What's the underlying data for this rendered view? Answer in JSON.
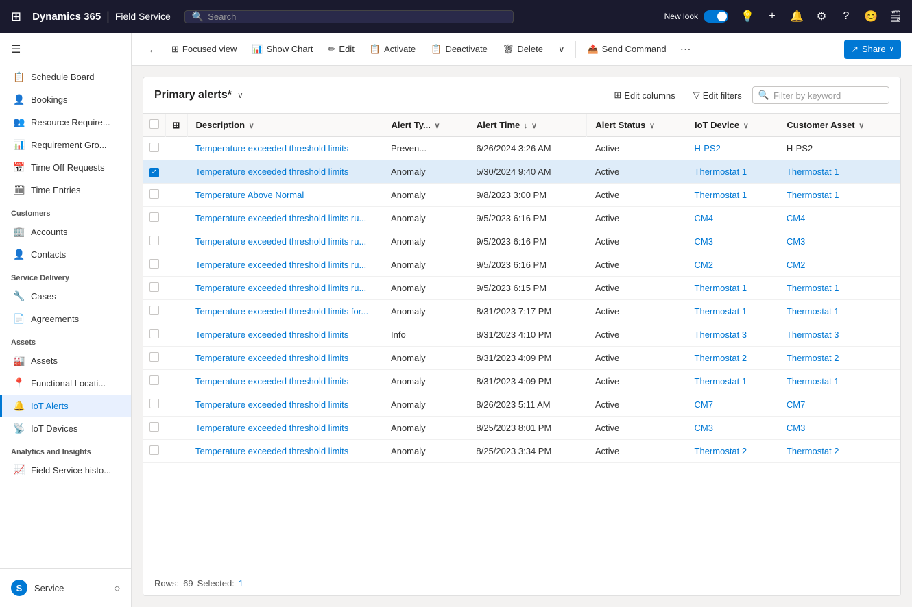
{
  "app": {
    "title": "Dynamics 365",
    "module": "Field Service",
    "search_placeholder": "Search"
  },
  "topnav": {
    "new_look_label": "New look",
    "icons": [
      "💡",
      "+",
      "🔔",
      "⚙",
      "?",
      "😊",
      "🗒"
    ]
  },
  "sidebar": {
    "sections": [
      {
        "items": [
          {
            "id": "schedule-board",
            "label": "Schedule Board",
            "icon": "📋"
          },
          {
            "id": "bookings",
            "label": "Bookings",
            "icon": "👤"
          }
        ]
      },
      {
        "items": [
          {
            "id": "resource-require",
            "label": "Resource Require...",
            "icon": "👥"
          },
          {
            "id": "requirement-gro",
            "label": "Requirement Gro...",
            "icon": "📊"
          },
          {
            "id": "time-off-requests",
            "label": "Time Off Requests",
            "icon": "📅"
          },
          {
            "id": "time-entries",
            "label": "Time Entries",
            "icon": "🗓"
          }
        ]
      },
      {
        "label": "Customers",
        "items": [
          {
            "id": "accounts",
            "label": "Accounts",
            "icon": "🏢"
          },
          {
            "id": "contacts",
            "label": "Contacts",
            "icon": "👤"
          }
        ]
      },
      {
        "label": "Service Delivery",
        "items": [
          {
            "id": "cases",
            "label": "Cases",
            "icon": "🔧"
          },
          {
            "id": "agreements",
            "label": "Agreements",
            "icon": "📄"
          }
        ]
      },
      {
        "label": "Assets",
        "items": [
          {
            "id": "assets",
            "label": "Assets",
            "icon": "🏭"
          },
          {
            "id": "functional-locati",
            "label": "Functional Locati...",
            "icon": "📍"
          },
          {
            "id": "iot-alerts",
            "label": "IoT Alerts",
            "icon": "🔔"
          },
          {
            "id": "iot-devices",
            "label": "IoT Devices",
            "icon": "📡"
          }
        ]
      },
      {
        "label": "Analytics and Insights",
        "items": [
          {
            "id": "field-service-histo",
            "label": "Field Service histo...",
            "icon": "📈"
          }
        ]
      }
    ],
    "bottom": {
      "label": "Service",
      "badge": "S",
      "chevron": "◇"
    }
  },
  "toolbar": {
    "back_label": "←",
    "focused_view_label": "Focused view",
    "show_chart_label": "Show Chart",
    "edit_label": "Edit",
    "activate_label": "Activate",
    "deactivate_label": "Deactivate",
    "delete_label": "Delete",
    "send_command_label": "Send Command",
    "more_label": "⋯",
    "share_label": "Share"
  },
  "grid": {
    "title": "Primary alerts*",
    "edit_columns_label": "Edit columns",
    "edit_filters_label": "Edit filters",
    "filter_placeholder": "Filter by keyword",
    "columns": [
      {
        "id": "description",
        "label": "Description",
        "sortable": true,
        "sort_dir": "asc"
      },
      {
        "id": "alert-type",
        "label": "Alert Ty...",
        "sortable": true
      },
      {
        "id": "alert-time",
        "label": "Alert Time",
        "sortable": true,
        "sort_dir": "desc"
      },
      {
        "id": "alert-status",
        "label": "Alert Status",
        "sortable": true
      },
      {
        "id": "iot-device",
        "label": "IoT Device",
        "sortable": true
      },
      {
        "id": "customer-asset",
        "label": "Customer Asset",
        "sortable": true
      }
    ],
    "rows": [
      {
        "id": 1,
        "description": "Temperature exceeded threshold limits",
        "alert_type": "Preven...",
        "alert_time": "6/26/2024 3:26 AM",
        "alert_status": "Active",
        "iot_device": "H-PS2",
        "iot_device_link": true,
        "customer_asset": "H-PS2",
        "customer_asset_link": false,
        "selected": false
      },
      {
        "id": 2,
        "description": "Temperature exceeded threshold limits",
        "alert_type": "Anomaly",
        "alert_time": "5/30/2024 9:40 AM",
        "alert_status": "Active",
        "iot_device": "Thermostat 1",
        "iot_device_link": true,
        "customer_asset": "Thermostat 1",
        "customer_asset_link": true,
        "selected": true
      },
      {
        "id": 3,
        "description": "Temperature Above Normal",
        "alert_type": "Anomaly",
        "alert_time": "9/8/2023 3:00 PM",
        "alert_status": "Active",
        "iot_device": "Thermostat 1",
        "iot_device_link": true,
        "customer_asset": "Thermostat 1",
        "customer_asset_link": true,
        "selected": false
      },
      {
        "id": 4,
        "description": "Temperature exceeded threshold limits ru...",
        "alert_type": "Anomaly",
        "alert_time": "9/5/2023 6:16 PM",
        "alert_status": "Active",
        "iot_device": "CM4",
        "iot_device_link": true,
        "customer_asset": "CM4",
        "customer_asset_link": true,
        "selected": false
      },
      {
        "id": 5,
        "description": "Temperature exceeded threshold limits ru...",
        "alert_type": "Anomaly",
        "alert_time": "9/5/2023 6:16 PM",
        "alert_status": "Active",
        "iot_device": "CM3",
        "iot_device_link": true,
        "customer_asset": "CM3",
        "customer_asset_link": true,
        "selected": false
      },
      {
        "id": 6,
        "description": "Temperature exceeded threshold limits ru...",
        "alert_type": "Anomaly",
        "alert_time": "9/5/2023 6:16 PM",
        "alert_status": "Active",
        "iot_device": "CM2",
        "iot_device_link": true,
        "customer_asset": "CM2",
        "customer_asset_link": true,
        "selected": false
      },
      {
        "id": 7,
        "description": "Temperature exceeded threshold limits ru...",
        "alert_type": "Anomaly",
        "alert_time": "9/5/2023 6:15 PM",
        "alert_status": "Active",
        "iot_device": "Thermostat 1",
        "iot_device_link": true,
        "customer_asset": "Thermostat 1",
        "customer_asset_link": true,
        "selected": false
      },
      {
        "id": 8,
        "description": "Temperature exceeded threshold limits for...",
        "alert_type": "Anomaly",
        "alert_time": "8/31/2023 7:17 PM",
        "alert_status": "Active",
        "iot_device": "Thermostat 1",
        "iot_device_link": true,
        "customer_asset": "Thermostat 1",
        "customer_asset_link": true,
        "selected": false
      },
      {
        "id": 9,
        "description": "Temperature exceeded threshold limits",
        "alert_type": "Info",
        "alert_time": "8/31/2023 4:10 PM",
        "alert_status": "Active",
        "iot_device": "Thermostat 3",
        "iot_device_link": true,
        "customer_asset": "Thermostat 3",
        "customer_asset_link": true,
        "selected": false
      },
      {
        "id": 10,
        "description": "Temperature exceeded threshold limits",
        "alert_type": "Anomaly",
        "alert_time": "8/31/2023 4:09 PM",
        "alert_status": "Active",
        "iot_device": "Thermostat 2",
        "iot_device_link": true,
        "customer_asset": "Thermostat 2",
        "customer_asset_link": true,
        "selected": false
      },
      {
        "id": 11,
        "description": "Temperature exceeded threshold limits",
        "alert_type": "Anomaly",
        "alert_time": "8/31/2023 4:09 PM",
        "alert_status": "Active",
        "iot_device": "Thermostat 1",
        "iot_device_link": true,
        "customer_asset": "Thermostat 1",
        "customer_asset_link": true,
        "selected": false
      },
      {
        "id": 12,
        "description": "Temperature exceeded threshold limits",
        "alert_type": "Anomaly",
        "alert_time": "8/26/2023 5:11 AM",
        "alert_status": "Active",
        "iot_device": "CM7",
        "iot_device_link": true,
        "customer_asset": "CM7",
        "customer_asset_link": true,
        "selected": false
      },
      {
        "id": 13,
        "description": "Temperature exceeded threshold limits",
        "alert_type": "Anomaly",
        "alert_time": "8/25/2023 8:01 PM",
        "alert_status": "Active",
        "iot_device": "CM3",
        "iot_device_link": true,
        "customer_asset": "CM3",
        "customer_asset_link": true,
        "selected": false
      },
      {
        "id": 14,
        "description": "Temperature exceeded threshold limits",
        "alert_type": "Anomaly",
        "alert_time": "8/25/2023 3:34 PM",
        "alert_status": "Active",
        "iot_device": "Thermostat 2",
        "iot_device_link": true,
        "customer_asset": "Thermostat 2",
        "customer_asset_link": true,
        "selected": false
      }
    ],
    "footer": {
      "rows_label": "Rows:",
      "rows_count": "69",
      "selected_label": "Selected:",
      "selected_count": "1"
    }
  }
}
